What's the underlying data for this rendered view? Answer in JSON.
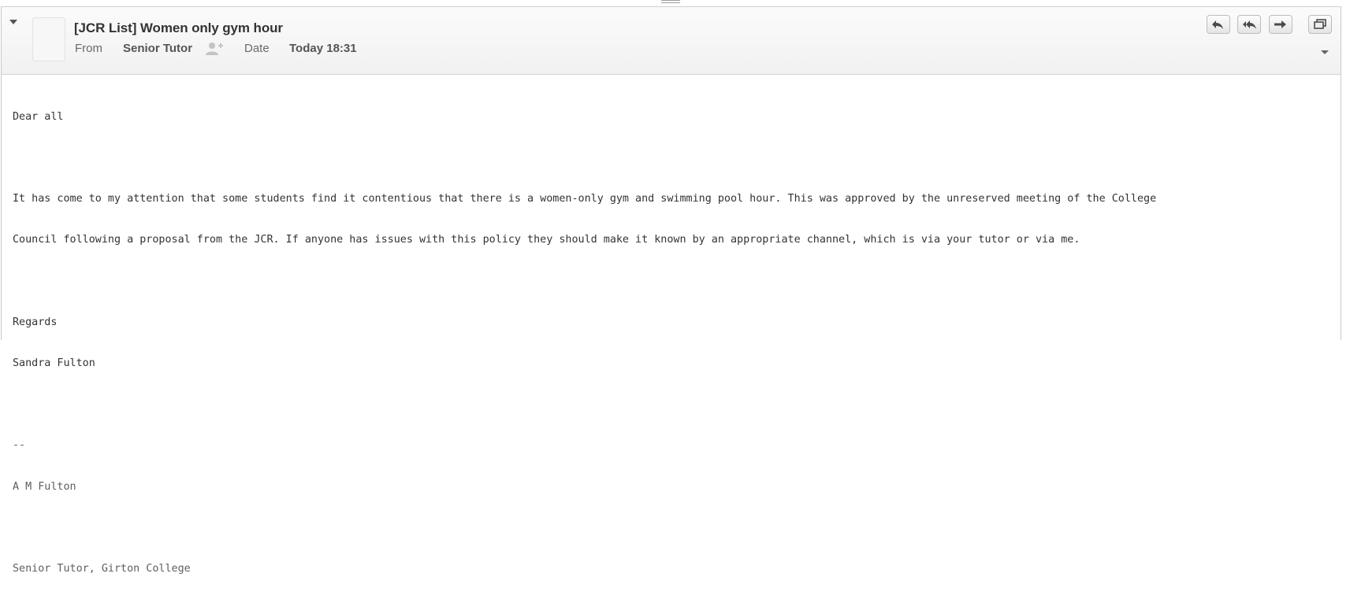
{
  "message": {
    "subject": "[JCR List] Women only gym hour",
    "from_label": "From",
    "from_value": "Senior Tutor",
    "date_label": "Date",
    "date_value": "Today 18:31"
  },
  "toolbar": {
    "icons": [
      "reply-icon",
      "reply-all-icon",
      "forward-icon",
      "open-in-new-window-icon"
    ]
  },
  "body": {
    "greeting": "Dear all",
    "paragraph_line_1": "It has come to my attention that some students find it contentious that there is a women-only gym and swimming pool hour. This was approved by the unreserved meeting of the College",
    "paragraph_line_2": "Council following a proposal from the JCR. If anyone has issues with this policy they should make it known by an appropriate channel, which is via your tutor or via me.",
    "closing": "Regards",
    "sender_name": "Sandra Fulton"
  },
  "signature": {
    "separator": "--",
    "name": "A M Fulton",
    "title": "Senior Tutor, Girton College"
  }
}
